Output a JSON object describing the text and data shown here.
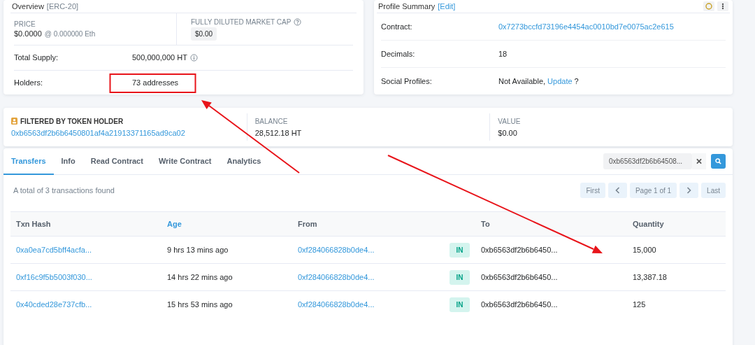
{
  "overview": {
    "title": "Overview",
    "badge": "[ERC-20]",
    "price": {
      "label": "PRICE",
      "value": "$0.0000",
      "eth": "@ 0.000000 Eth"
    },
    "market_cap": {
      "label": "FULLY DILUTED MARKET CAP",
      "value": "$0.00"
    },
    "rows": [
      {
        "label": "Total Supply:",
        "value": "500,000,000 HT",
        "info": true
      },
      {
        "label": "Holders:",
        "value": "73 addresses",
        "info": false
      }
    ]
  },
  "profile": {
    "title": "Profile Summary",
    "edit": "[Edit]",
    "rows": [
      {
        "label": "Contract:",
        "kind": "link",
        "value": "0x7273bccfd73196e4454ac0010bd7e0075ac2e615"
      },
      {
        "label": "Decimals:",
        "kind": "text",
        "value": "18"
      },
      {
        "label": "Social Profiles:",
        "kind": "social",
        "value": "Not Available,",
        "link": "Update",
        "suffix": "?"
      }
    ]
  },
  "filter": {
    "label": "FILTERED BY TOKEN HOLDER",
    "address": "0xb6563df2b6b6450801af4a21913371165ad9ca02",
    "balance": {
      "label": "BALANCE",
      "value": "28,512.18 HT"
    },
    "value": {
      "label": "VALUE",
      "value": "$0.00"
    }
  },
  "tabs": [
    {
      "label": "Transfers",
      "selected": true
    },
    {
      "label": "Info",
      "selected": false
    },
    {
      "label": "Read Contract",
      "selected": false
    },
    {
      "label": "Write Contract",
      "selected": false
    },
    {
      "label": "Analytics",
      "selected": false
    }
  ],
  "search": {
    "value": "0xb6563df2b6b64508..."
  },
  "summary": "A total of 3 transactions found",
  "pagination": {
    "first": "First",
    "page": "Page 1 of 1",
    "last": "Last"
  },
  "table": {
    "columns": [
      {
        "label": "Txn Hash",
        "link": false
      },
      {
        "label": "Age",
        "link": true
      },
      {
        "label": "From",
        "link": false
      },
      {
        "label": "To",
        "link": false
      },
      {
        "label": "Quantity",
        "link": false
      }
    ],
    "rows": [
      {
        "hash": "0xa0ea7cd5bff4acfa...",
        "age": "9 hrs 13 mins ago",
        "from": "0xf284066828b0de4...",
        "direction": "IN",
        "to": "0xb6563df2b6b6450...",
        "quantity": "15,000"
      },
      {
        "hash": "0xf16c9f5b5003f030...",
        "age": "14 hrs 22 mins ago",
        "from": "0xf284066828b0de4...",
        "direction": "IN",
        "to": "0xb6563df2b6b6450...",
        "quantity": "13,387.18"
      },
      {
        "hash": "0x40cded28e737cfb...",
        "age": "15 hrs 53 mins ago",
        "from": "0xf284066828b0de4...",
        "direction": "IN",
        "to": "0xb6563df2b6b6450...",
        "quantity": "125"
      }
    ]
  }
}
